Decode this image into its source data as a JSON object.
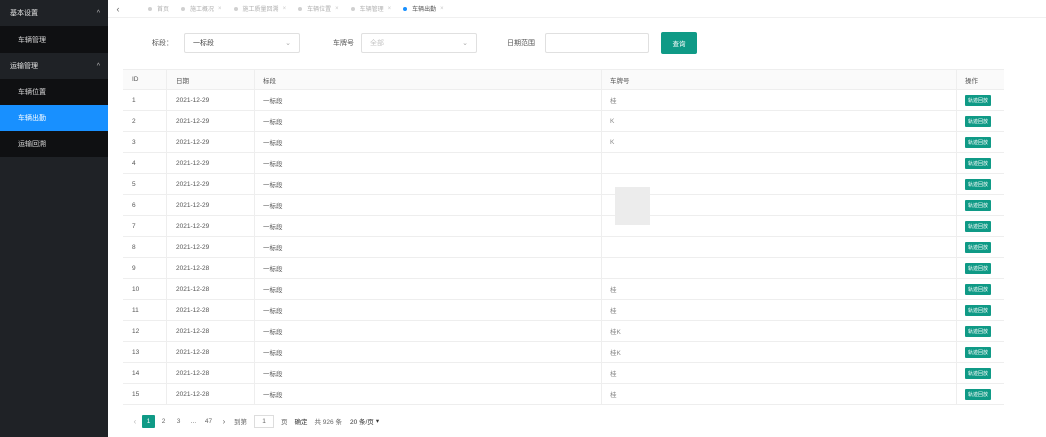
{
  "sidebar": {
    "groups": [
      {
        "label": "基本设置",
        "chevron": "^"
      },
      {
        "label": "运输管理",
        "chevron": "^"
      }
    ],
    "items": [
      {
        "label": "车辆管理"
      },
      {
        "label": "车辆位置"
      },
      {
        "label": "车辆出勤"
      },
      {
        "label": "运输回溯"
      }
    ]
  },
  "tabs": {
    "back": "‹",
    "items": [
      {
        "label": "首页",
        "close": ""
      },
      {
        "label": "施工概况",
        "close": "×"
      },
      {
        "label": "施工质量回溯",
        "close": "×"
      },
      {
        "label": "车辆位置",
        "close": "×"
      },
      {
        "label": "车辆管理",
        "close": "×"
      },
      {
        "label": "车辆出勤",
        "close": "×"
      }
    ]
  },
  "filters": {
    "section_label": "标段：",
    "section_value": "一标段",
    "plate_label": "车牌号",
    "plate_placeholder": "全部",
    "date_label": "日期范围",
    "query_button": "查询",
    "caret": "⌄"
  },
  "table": {
    "headers": [
      "ID",
      "日期",
      "标段",
      "车牌号",
      "操作"
    ],
    "op_label": "轨迹回放",
    "rows": [
      {
        "id": "1",
        "date": "2021-12-29",
        "section": "一标段",
        "plate": "桂"
      },
      {
        "id": "2",
        "date": "2021-12-29",
        "section": "一标段",
        "plate": "K"
      },
      {
        "id": "3",
        "date": "2021-12-29",
        "section": "一标段",
        "plate": "K"
      },
      {
        "id": "4",
        "date": "2021-12-29",
        "section": "一标段",
        "plate": ""
      },
      {
        "id": "5",
        "date": "2021-12-29",
        "section": "一标段",
        "plate": ""
      },
      {
        "id": "6",
        "date": "2021-12-29",
        "section": "一标段",
        "plate": ""
      },
      {
        "id": "7",
        "date": "2021-12-29",
        "section": "一标段",
        "plate": ""
      },
      {
        "id": "8",
        "date": "2021-12-29",
        "section": "一标段",
        "plate": ""
      },
      {
        "id": "9",
        "date": "2021-12-28",
        "section": "一标段",
        "plate": ""
      },
      {
        "id": "10",
        "date": "2021-12-28",
        "section": "一标段",
        "plate": "桂"
      },
      {
        "id": "11",
        "date": "2021-12-28",
        "section": "一标段",
        "plate": "桂"
      },
      {
        "id": "12",
        "date": "2021-12-28",
        "section": "一标段",
        "plate": "桂K"
      },
      {
        "id": "13",
        "date": "2021-12-28",
        "section": "一标段",
        "plate": "桂K"
      },
      {
        "id": "14",
        "date": "2021-12-28",
        "section": "一标段",
        "plate": "桂"
      },
      {
        "id": "15",
        "date": "2021-12-28",
        "section": "一标段",
        "plate": "桂"
      }
    ]
  },
  "pagination": {
    "prev": "‹",
    "pages": [
      "1",
      "2",
      "3",
      "...",
      "47"
    ],
    "active_page": "1",
    "next": "›",
    "goto_label": "到第",
    "goto_value": "1",
    "page_unit": "页",
    "confirm": "确定",
    "total": "共 926 条",
    "page_size": "20 条/页",
    "page_size_caret": "▾"
  }
}
